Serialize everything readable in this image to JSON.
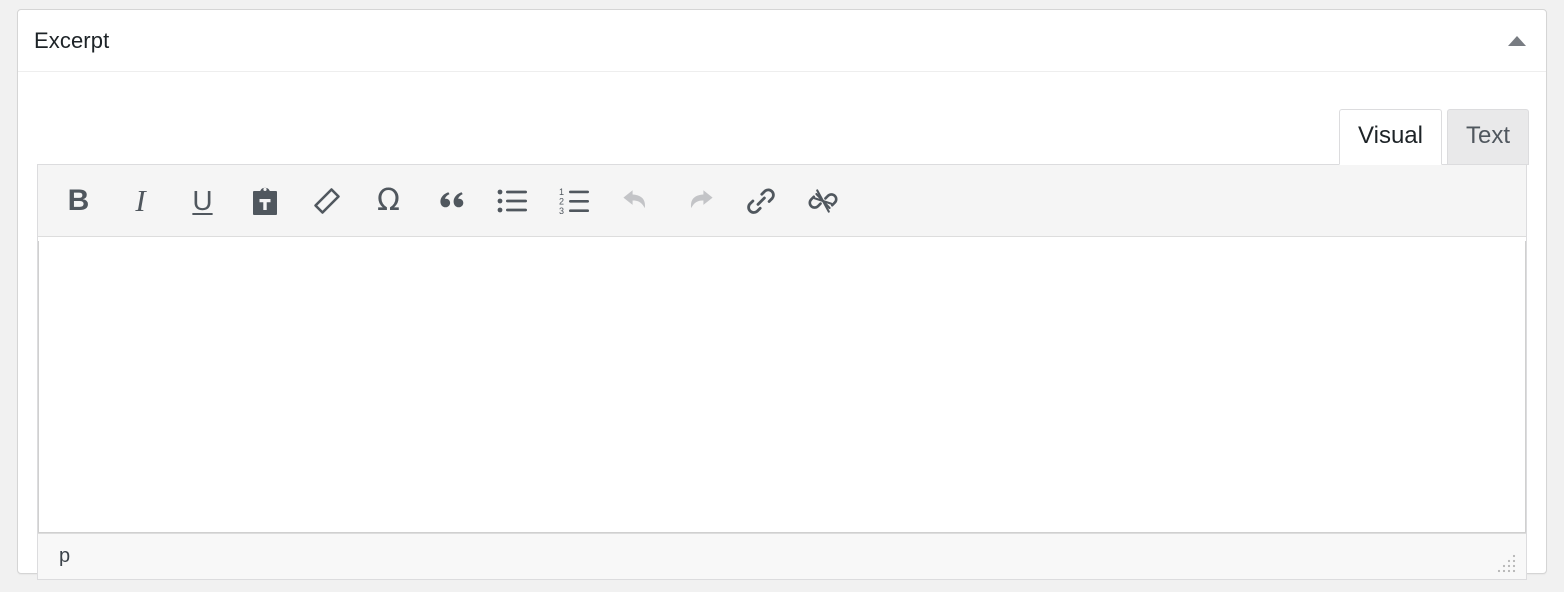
{
  "panel": {
    "title": "Excerpt",
    "toggle": {
      "name": "toggle-panel-button",
      "icon": "triangle-up-icon",
      "state": "expanded"
    }
  },
  "editor": {
    "tabs": [
      {
        "id": "visual",
        "label": "Visual",
        "active": true
      },
      {
        "id": "text",
        "label": "Text",
        "active": false
      }
    ],
    "toolbar": [
      {
        "id": "bold",
        "icon": "bold-icon",
        "label": "B",
        "disabled": false
      },
      {
        "id": "italic",
        "icon": "italic-icon",
        "label": "I",
        "disabled": false
      },
      {
        "id": "underline",
        "icon": "underline-icon",
        "label": "U",
        "disabled": false
      },
      {
        "id": "paste-as-text",
        "icon": "clipboard-text-icon",
        "label": "",
        "disabled": false
      },
      {
        "id": "remove-format",
        "icon": "eraser-icon",
        "label": "",
        "disabled": false
      },
      {
        "id": "special-char",
        "icon": "omega-icon",
        "label": "Ω",
        "disabled": false
      },
      {
        "id": "blockquote",
        "icon": "quote-icon",
        "label": "“",
        "disabled": false
      },
      {
        "id": "bullet-list",
        "icon": "bullet-list-icon",
        "label": "",
        "disabled": false
      },
      {
        "id": "numbered-list",
        "icon": "numbered-list-icon",
        "label": "",
        "disabled": false
      },
      {
        "id": "undo",
        "icon": "undo-arrow-icon",
        "label": "",
        "disabled": true
      },
      {
        "id": "redo",
        "icon": "redo-arrow-icon",
        "label": "",
        "disabled": true
      },
      {
        "id": "insert-link",
        "icon": "link-icon",
        "label": "",
        "disabled": false
      },
      {
        "id": "remove-link",
        "icon": "unlink-icon",
        "label": "",
        "disabled": false
      }
    ],
    "numbered_list_digits": [
      "1",
      "2",
      "3"
    ],
    "content": "",
    "statusbar": {
      "element_path": "p",
      "resize_handle_icon": "resize-grip-icon"
    }
  },
  "colors": {
    "page_background": "#f1f1f1",
    "panel_background": "#ffffff",
    "panel_border": "#d5d5d5",
    "toolbar_background": "#f5f5f5",
    "icon": "#50575e",
    "icon_disabled": "#c3c4c7",
    "title_text": "#1d2327",
    "toggle_arrow": "#787c82",
    "active_tab_background": "#ffffff",
    "inactive_tab_background": "#e9e9ea"
  }
}
